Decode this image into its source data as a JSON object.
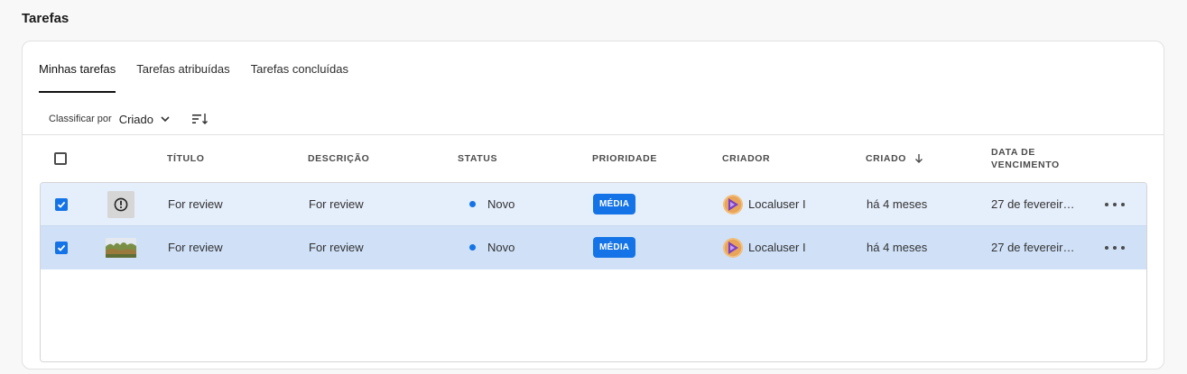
{
  "page": {
    "title": "Tarefas"
  },
  "tabs": [
    {
      "label": "Minhas tarefas",
      "active": true
    },
    {
      "label": "Tarefas atribuídas",
      "active": false
    },
    {
      "label": "Tarefas concluídas",
      "active": false
    }
  ],
  "sort": {
    "label": "Classificar por",
    "value": "Criado",
    "icon": "chevron-down-icon",
    "direction_icon": "sort-descending-icon"
  },
  "table": {
    "columns": {
      "title": "TÍTULO",
      "description": "DESCRIÇÃO",
      "status": "STATUS",
      "priority": "PRIORIDADE",
      "creator": "CRIADOR",
      "created": "CRIADO",
      "due_line1": "DATA DE",
      "due_line2": "VENCIMENTO"
    },
    "created_sort_icon": "arrow-down-icon",
    "rows": [
      {
        "checked": true,
        "thumbnail": "alert-icon",
        "title": "For review",
        "description": "For review",
        "status": "Novo",
        "priority": "MÉDIA",
        "creator": "Localuser I",
        "created": "há 4 meses",
        "due": "27 de fevereir…"
      },
      {
        "checked": true,
        "thumbnail": "photo-thumbnail",
        "title": "For review",
        "description": "For review",
        "status": "Novo",
        "priority": "MÉDIA",
        "creator": "Localuser I",
        "created": "há 4 meses",
        "due": "27 de fevereir…"
      }
    ]
  },
  "colors": {
    "accent": "#1473e6",
    "row_selected": "#cfe0f7",
    "row_selected_light": "#e5eefb"
  }
}
